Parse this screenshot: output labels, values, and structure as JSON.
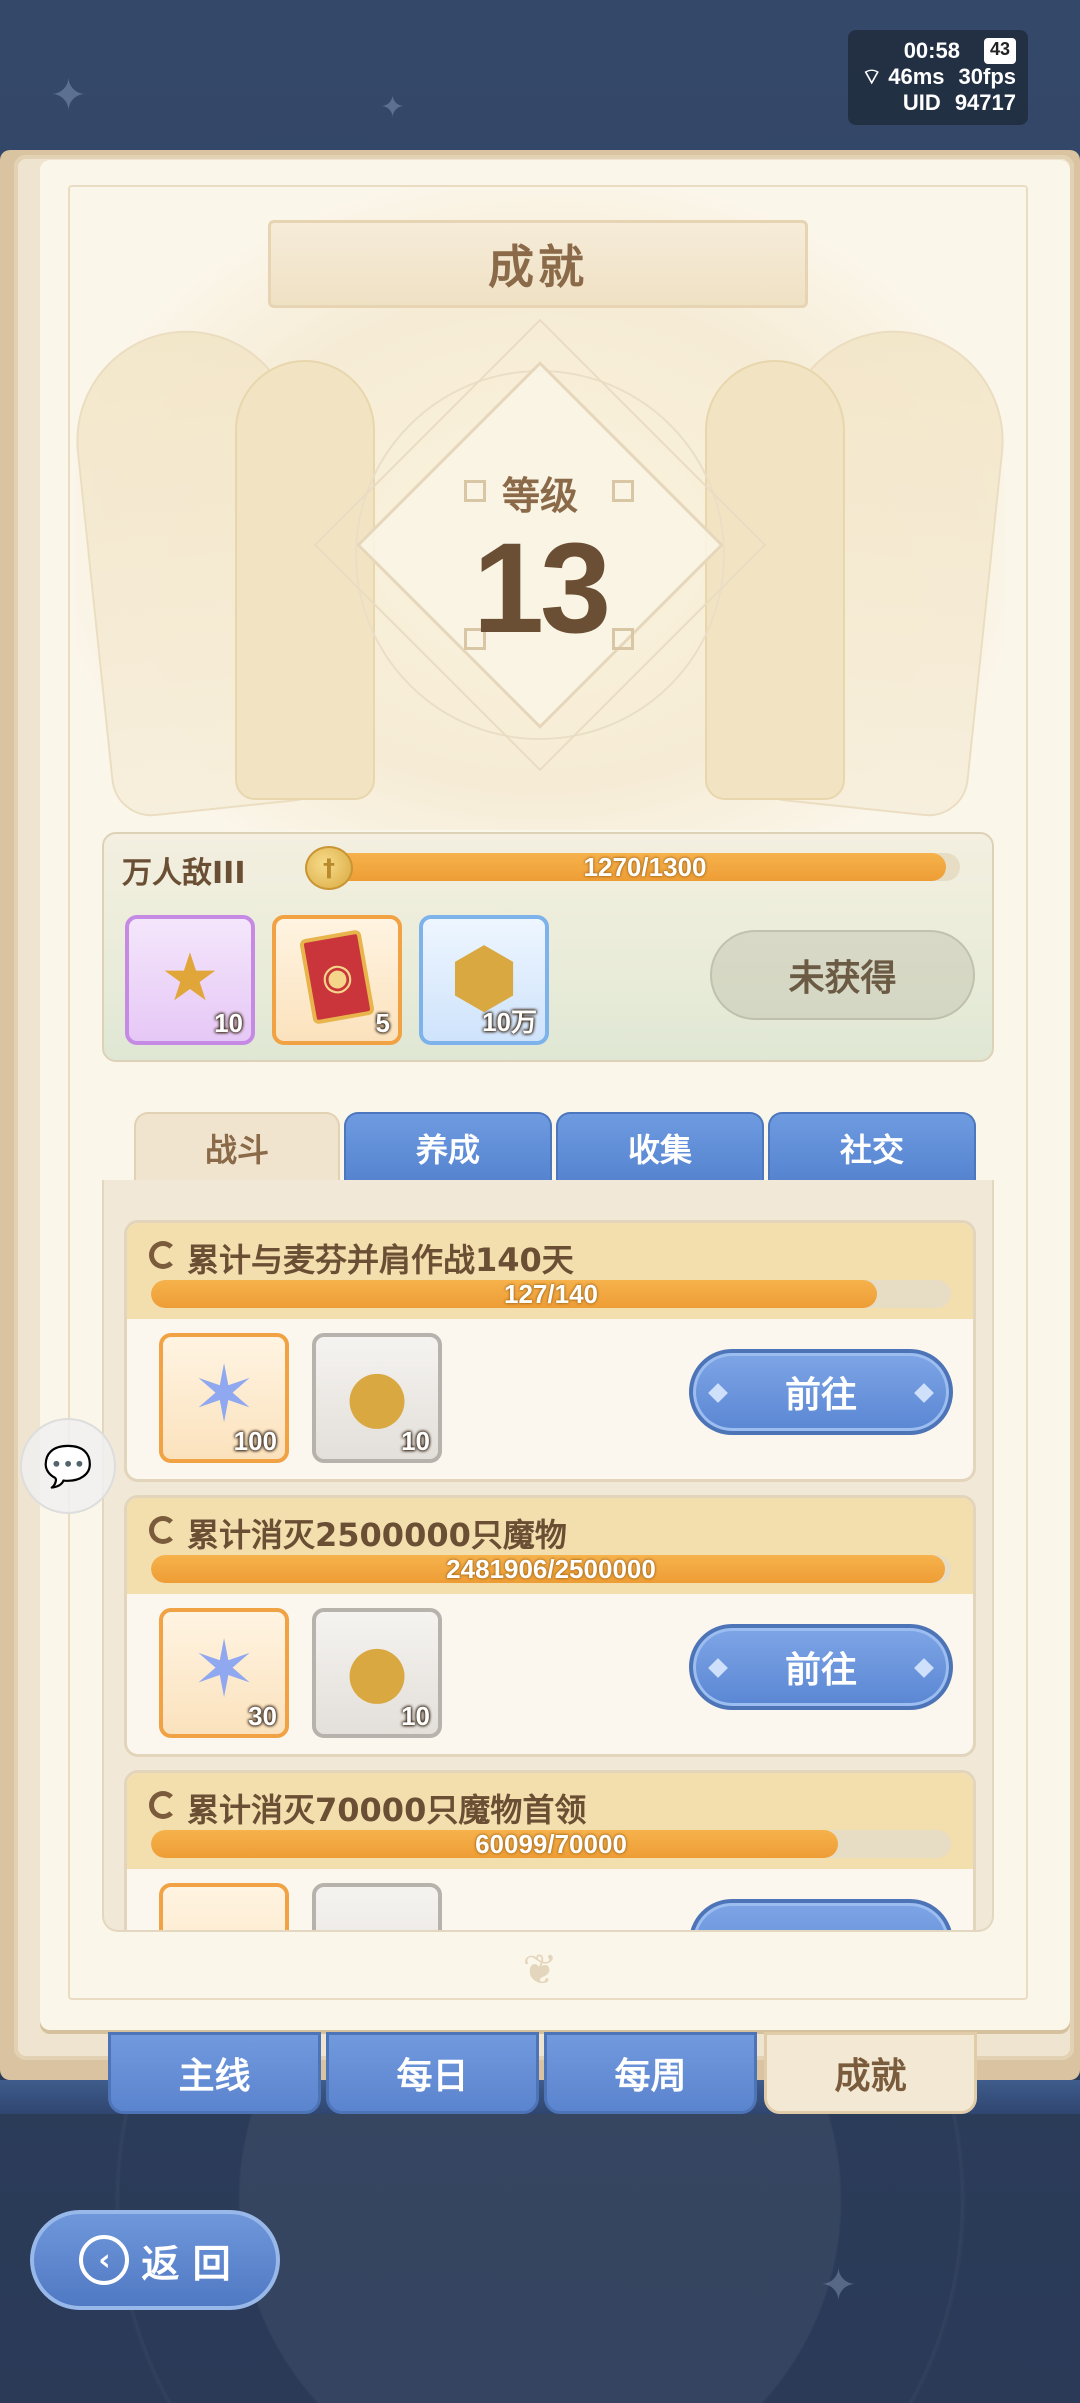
{
  "status": {
    "time": "00:58",
    "battery": "43",
    "ping": "46ms",
    "fps": "30fps",
    "uid_label": "UID",
    "uid_value": "94717"
  },
  "header": {
    "title": "成就"
  },
  "level": {
    "label": "等级",
    "value": "13"
  },
  "tier": {
    "name": "万人敌III",
    "progress_text": "1270/1300",
    "progress_fraction": 0.977,
    "rewards": [
      {
        "icon": "star-badge-icon",
        "count": "10",
        "rarity": "purple"
      },
      {
        "icon": "red-card-icon",
        "count": "5",
        "rarity": "orange"
      },
      {
        "icon": "gold-hexagon-coin-icon",
        "count": "10万",
        "rarity": "blue"
      }
    ],
    "button_label": "未获得"
  },
  "tabs": [
    {
      "label": "战斗",
      "active": true
    },
    {
      "label": "养成",
      "active": false
    },
    {
      "label": "收集",
      "active": false
    },
    {
      "label": "社交",
      "active": false
    }
  ],
  "achievements": [
    {
      "title": "累计与麦芬并肩作战140天",
      "progress_text": "127/140",
      "progress_fraction": 0.907,
      "rewards": [
        {
          "icon": "crystal-star-icon",
          "count": "100",
          "rarity": "orange"
        },
        {
          "icon": "winged-coin-icon",
          "count": "10",
          "rarity": "gray"
        }
      ],
      "button_label": "前往"
    },
    {
      "title": "累计消灭2500000只魔物",
      "progress_text": "2481906/2500000",
      "progress_fraction": 0.993,
      "rewards": [
        {
          "icon": "crystal-star-icon",
          "count": "30",
          "rarity": "orange"
        },
        {
          "icon": "winged-coin-icon",
          "count": "10",
          "rarity": "gray"
        }
      ],
      "button_label": "前往"
    },
    {
      "title": "累计消灭70000只魔物首领",
      "progress_text": "60099/70000",
      "progress_fraction": 0.859,
      "rewards": [],
      "button_label": ""
    }
  ],
  "bottom_tabs": [
    {
      "label": "主线",
      "active": false
    },
    {
      "label": "每日",
      "active": false
    },
    {
      "label": "每周",
      "active": false
    },
    {
      "label": "成就",
      "active": true
    }
  ],
  "back_button": {
    "label": "返 回"
  },
  "colors": {
    "accent_blue": "#5a86d3",
    "progress_orange": "#ee9d35",
    "parchment": "#fbf6ea",
    "text_brown": "#6b4f34"
  }
}
